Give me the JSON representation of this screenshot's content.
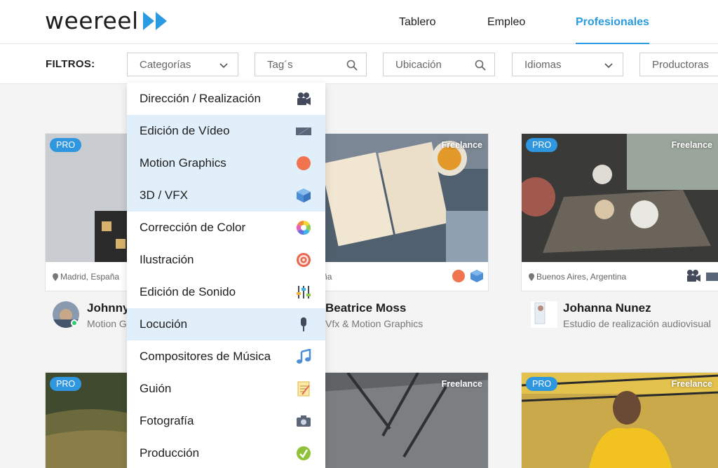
{
  "brand": {
    "name": "weereel"
  },
  "nav": {
    "tablero": "Tablero",
    "empleo": "Empleo",
    "profesionales": "Profesionales"
  },
  "filters": {
    "label": "FILTROS:",
    "categorias": "Categorías",
    "tags": "Tag´s",
    "ubicacion": "Ubicación",
    "idiomas": "Idiomas",
    "productoras": "Productoras"
  },
  "dropdown": {
    "items": [
      {
        "label": "Dirección / Realización",
        "icon": "movie-camera-icon",
        "highlighted": false
      },
      {
        "label": "Edición de Vídeo",
        "icon": "video-editing-icon",
        "highlighted": true
      },
      {
        "label": "Motion Graphics",
        "icon": "orange-circle-icon",
        "highlighted": true
      },
      {
        "label": "3D / VFX",
        "icon": "cube-icon",
        "highlighted": true
      },
      {
        "label": "Corrección de Color",
        "icon": "color-wheel-icon",
        "highlighted": false
      },
      {
        "label": "Ilustración",
        "icon": "target-icon",
        "highlighted": false
      },
      {
        "label": "Edición de Sonido",
        "icon": "sliders-icon",
        "highlighted": false
      },
      {
        "label": "Locución",
        "icon": "microphone-icon",
        "highlighted": true
      },
      {
        "label": "Compositores de Música",
        "icon": "music-note-icon",
        "highlighted": false
      },
      {
        "label": "Guión",
        "icon": "notepad-icon",
        "highlighted": false
      },
      {
        "label": "Fotografía",
        "icon": "camera-icon",
        "highlighted": false
      },
      {
        "label": "Producción",
        "icon": "production-icon",
        "highlighted": false
      }
    ]
  },
  "cards": [
    {
      "badge": "PRO",
      "location": "Madrid, España",
      "name": "Johnny",
      "subtitle": "Motion G"
    },
    {
      "badge": "Freelance",
      "location": ", España",
      "name": "Beatrice Moss",
      "subtitle": "Vfx & Motion Graphics"
    },
    {
      "badge_pro": "PRO",
      "badge_free": "Freelance",
      "location": "Buenos Aires, Argentina",
      "name": "Johanna Nunez",
      "subtitle": "Estudio de realización audiovisual"
    }
  ],
  "cards_row2": [
    {
      "badge": "PRO"
    },
    {
      "badge": "Freelance"
    },
    {
      "badge_pro": "PRO",
      "badge_free": "Freelance"
    }
  ],
  "colors": {
    "accent": "#2a9be0",
    "pro_badge": "#2f96e0",
    "highlight": "#e1effa",
    "online": "#2ecc71"
  }
}
